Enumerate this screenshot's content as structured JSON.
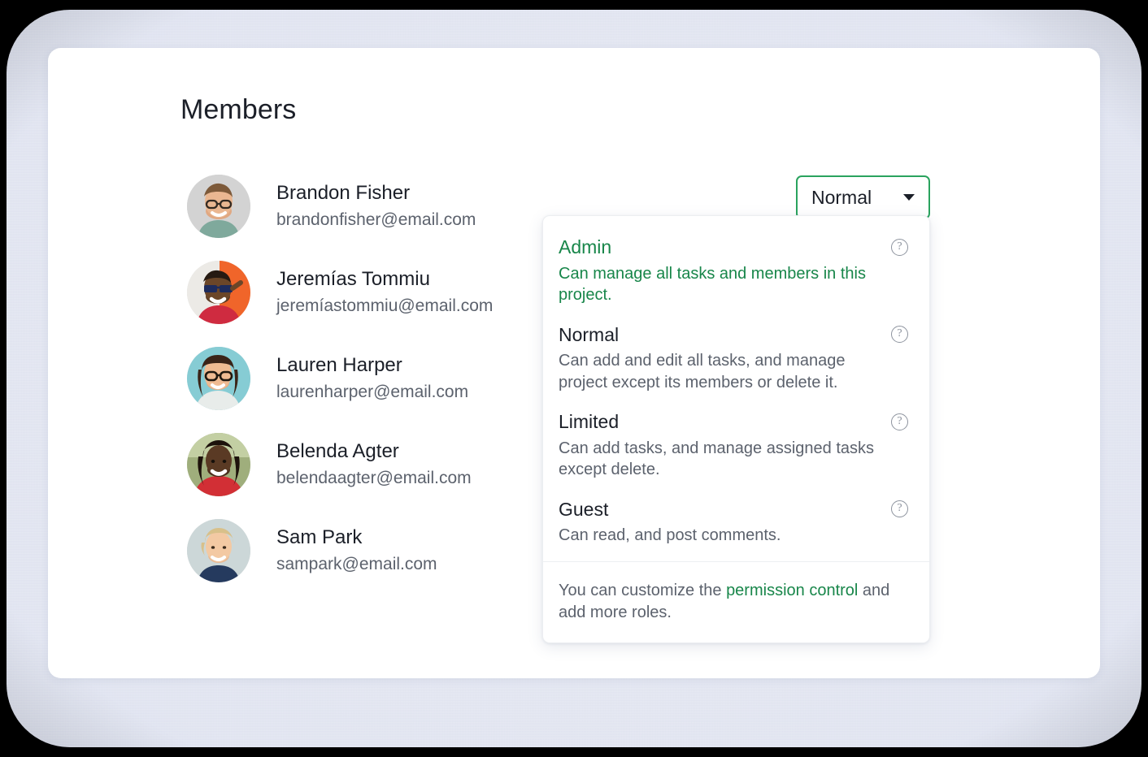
{
  "page": {
    "title": "Members",
    "background_color": "#dee2ef",
    "card_color": "#ffffff",
    "accent_green": "#18864a"
  },
  "members": [
    {
      "name": "Brandon Fisher",
      "email": "brandonfisher@email.com",
      "avatar": "avatar-brandon-fisher"
    },
    {
      "name": "Jeremías Tommiu",
      "email": "jeremíastommiu@email.com",
      "avatar": "avatar-jeremias-tommiu"
    },
    {
      "name": "Lauren Harper",
      "email": "laurenharper@email.com",
      "avatar": "avatar-lauren-harper"
    },
    {
      "name": "Belenda Agter",
      "email": "belendaagter@email.com",
      "avatar": "avatar-belenda-agter"
    },
    {
      "name": "Sam Park",
      "email": "sampark@email.com",
      "avatar": "avatar-sam-park"
    }
  ],
  "role_select": {
    "value": "Normal",
    "caret_icon": "chevron-down-icon"
  },
  "role_menu": {
    "help_icon": "question-mark-circle-icon",
    "options": [
      {
        "label": "Admin",
        "description": "Can manage all tasks and members in this project.",
        "selected": true
      },
      {
        "label": "Normal",
        "description": "Can add and edit all tasks, and manage project except its members or delete it.",
        "selected": false
      },
      {
        "label": "Limited",
        "description": "Can add tasks, and manage assigned tasks except delete.",
        "selected": false
      },
      {
        "label": "Guest",
        "description": "Can read, and post comments.",
        "selected": false
      }
    ],
    "footer": {
      "text_before": "You can customize the ",
      "link_text": "permission control",
      "text_after": " and add more roles."
    }
  }
}
